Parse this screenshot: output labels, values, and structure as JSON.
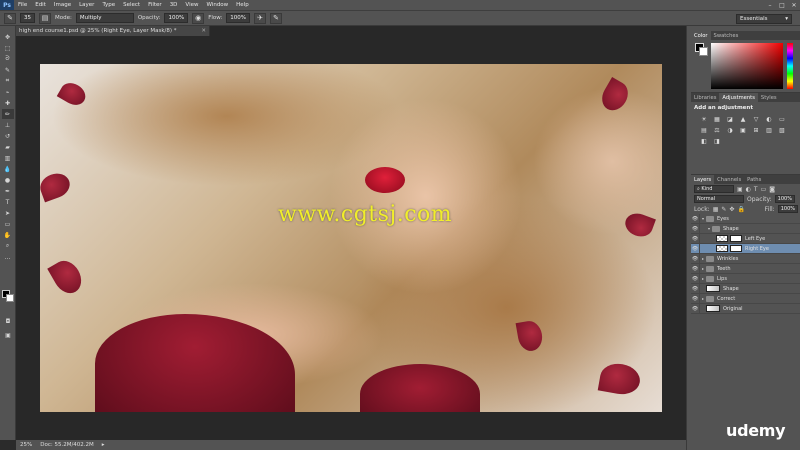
{
  "menubar": {
    "app_logo": "Ps",
    "menus": [
      "File",
      "Edit",
      "Image",
      "Layer",
      "Type",
      "Select",
      "Filter",
      "3D",
      "View",
      "Window",
      "Help"
    ],
    "window_buttons": [
      "–",
      "□",
      "✕"
    ]
  },
  "options_bar": {
    "brush_size": "35",
    "mode_label": "Mode:",
    "mode_value": "Multiply",
    "opacity_label": "Opacity:",
    "opacity_value": "100%",
    "flow_label": "Flow:",
    "flow_value": "100%",
    "workspace": "Essentials"
  },
  "document": {
    "tab_title": "high end course1.psd @ 25% (Right Eye, Layer Mask/8) *",
    "watermark_text": "www.cgtsj.com"
  },
  "statusbar": {
    "zoom": "25%",
    "doc_info": "Doc: 55.2M/402.2M"
  },
  "color_panel": {
    "tabs": [
      "Color",
      "Swatches"
    ],
    "active_tab": "Color"
  },
  "adjustments_panel": {
    "tabs": [
      "Libraries",
      "Adjustments",
      "Styles"
    ],
    "active_tab": "Adjustments",
    "title": "Add an adjustment",
    "icons": [
      "☀",
      "▦",
      "◪",
      "▲",
      "▽",
      "◐",
      "▭",
      "▤",
      "⚖",
      "◑",
      "▣",
      "⊞",
      "▥",
      "▧",
      "◧",
      "◨",
      "▨",
      "▩"
    ]
  },
  "layers_panel": {
    "tabs": [
      "Layers",
      "Channels",
      "Paths"
    ],
    "active_tab": "Layers",
    "kind_filter": "Kind",
    "blend_mode": "Normal",
    "opacity_label": "Opacity:",
    "opacity_value": "100%",
    "lock_label": "Lock:",
    "fill_label": "Fill:",
    "fill_value": "100%",
    "layers": [
      {
        "name": "Eyes",
        "type": "group",
        "expanded": true,
        "indent": 0
      },
      {
        "name": "Shape",
        "type": "group",
        "expanded": true,
        "indent": 1
      },
      {
        "name": "Left Eye",
        "type": "layer-mask",
        "indent": 2
      },
      {
        "name": "Right Eye",
        "type": "layer-mask",
        "indent": 2,
        "selected": true
      },
      {
        "name": "Wrinkles",
        "type": "group",
        "expanded": false,
        "indent": 0
      },
      {
        "name": "Teeth",
        "type": "group",
        "expanded": false,
        "indent": 0
      },
      {
        "name": "Lips",
        "type": "group",
        "expanded": false,
        "indent": 0
      },
      {
        "name": "Shape",
        "type": "adjustment",
        "indent": 0
      },
      {
        "name": "Correct",
        "type": "group",
        "expanded": false,
        "indent": 0
      },
      {
        "name": "Original",
        "type": "adjustment",
        "indent": 0
      }
    ],
    "footer_icons": [
      "⛓",
      "fx",
      "◙",
      "◐",
      "▭",
      "▣",
      "🗑"
    ]
  },
  "brand": {
    "text": "udemy"
  }
}
